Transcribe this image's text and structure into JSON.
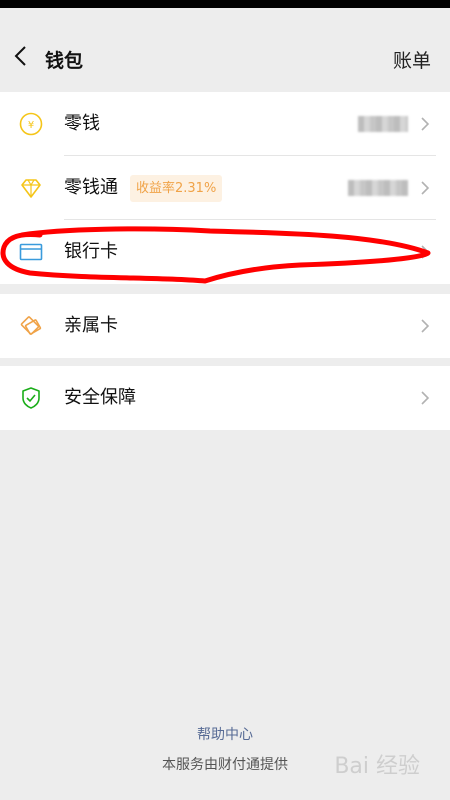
{
  "header": {
    "back_icon": "chevron-left-icon",
    "title": "钱包",
    "bill_label": "账单"
  },
  "groups": [
    {
      "items": [
        {
          "label": "零钱",
          "icon": "coin-yen-icon",
          "icon_color": "#f5c518"
        },
        {
          "label": "零钱通",
          "icon": "diamond-icon",
          "icon_color": "#f5c518",
          "badge": "收益率2.31%"
        },
        {
          "label": "银行卡",
          "icon": "bank-card-icon",
          "icon_color": "#3a9bdc"
        }
      ]
    },
    {
      "items": [
        {
          "label": "亲属卡",
          "icon": "family-card-icon",
          "icon_color": "#f0a348"
        }
      ]
    },
    {
      "items": [
        {
          "label": "安全保障",
          "icon": "shield-check-icon",
          "icon_color": "#1aad19"
        }
      ]
    }
  ],
  "footer": {
    "help_link": "帮助中心",
    "provider_note": "本服务由财付通提供"
  },
  "watermark": "Bai 经验",
  "colors": {
    "background": "#ededed",
    "link": "#576b95",
    "badge_text": "#f0a348",
    "annotation": "#ff0000"
  }
}
